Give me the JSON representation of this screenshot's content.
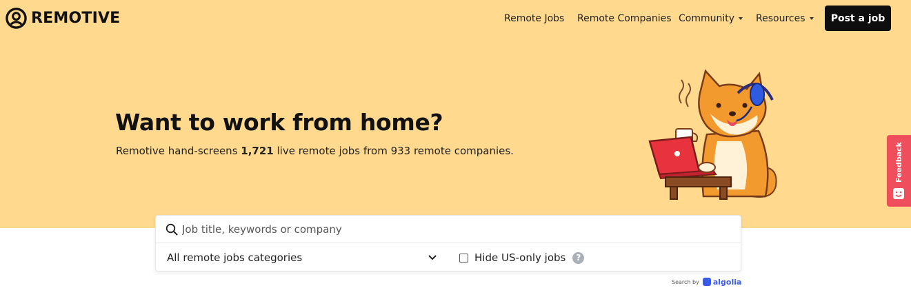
{
  "brand": {
    "name": "REMOTIVE"
  },
  "nav": {
    "items": [
      {
        "label": "Remote Jobs"
      },
      {
        "label": "Remote Companies"
      },
      {
        "label": "Community",
        "dropdown": true
      },
      {
        "label": "Resources",
        "dropdown": true
      }
    ],
    "cta_label": "Post a job"
  },
  "hero": {
    "title": "Want to work from home?",
    "sub_prefix": "Remotive hand-screens ",
    "job_count": "1,721",
    "sub_middle": " live remote jobs from 933 remote companies."
  },
  "feedback": {
    "label": "Feedback"
  },
  "search": {
    "placeholder": "Job title, keywords or company",
    "category_value": "All remote jobs categories",
    "hide_us_label": "Hide US-only jobs",
    "hide_us_checked": false,
    "help_glyph": "?"
  },
  "algolia": {
    "by": "Search by",
    "name": "algolia"
  },
  "colors": {
    "hero_bg": "#ffd98e",
    "cta_bg": "#0e0e0e",
    "feedback_bg": "#ef4e5c",
    "algolia": "#3a5ae8"
  },
  "icons": [
    "remotive-logo-icon",
    "caret-down-icon",
    "search-icon",
    "chevron-down-icon",
    "help-icon",
    "feedback-smile-icon",
    "algolia-icon",
    "shiba-illustration"
  ]
}
